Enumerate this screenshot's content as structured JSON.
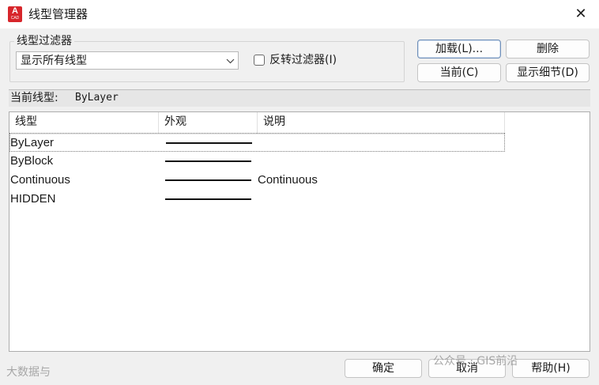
{
  "window": {
    "title": "线型管理器",
    "close_symbol": "✕",
    "icon_letter": "A",
    "icon_sub": "CAD"
  },
  "filter": {
    "group_label": "线型过滤器",
    "selected": "显示所有线型",
    "invert_label": "反转过滤器(I)"
  },
  "buttons": {
    "load": "加载(L)...",
    "delete": "删除",
    "current": "当前(C)",
    "details": "显示细节(D)",
    "ok": "确定",
    "cancel": "取消",
    "help": "帮助(H)"
  },
  "current_linetype": {
    "label": "当前线型:",
    "value": "ByLayer"
  },
  "table": {
    "columns": [
      "线型",
      "外观",
      "说明"
    ],
    "rows": [
      {
        "name": "ByLayer",
        "description": "",
        "selected": true
      },
      {
        "name": "ByBlock",
        "description": "",
        "selected": false
      },
      {
        "name": "Continuous",
        "description": "Continuous",
        "selected": false
      },
      {
        "name": "HIDDEN",
        "description": "",
        "selected": false
      }
    ]
  },
  "watermarks": {
    "left": "大数据与",
    "right": "公众号 · GIS前沿"
  },
  "colors": {
    "icon_red": "#d7262b",
    "dialog_bg": "#f0f0f0",
    "primary_border": "#6f8fb8"
  }
}
